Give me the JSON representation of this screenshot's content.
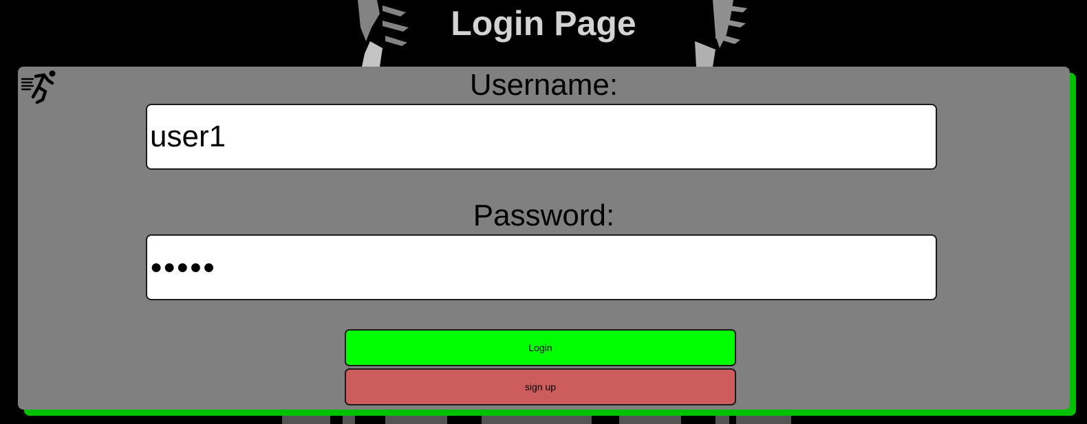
{
  "page": {
    "title": "Login Page"
  },
  "form": {
    "logo_icon": "running-person-icon",
    "username": {
      "label": "Username:",
      "value": "user1"
    },
    "password": {
      "label": "Password:",
      "masked_value": "●●●●●"
    },
    "login_button": {
      "label": "Login"
    },
    "signup_button": {
      "label": "sign up"
    }
  },
  "colors": {
    "background": "#000000",
    "title": "#d3d3d3",
    "card": "#808080",
    "card_shadow": "#00c000",
    "login_button": "#00ff00",
    "signup_button": "#cd5c5c"
  }
}
